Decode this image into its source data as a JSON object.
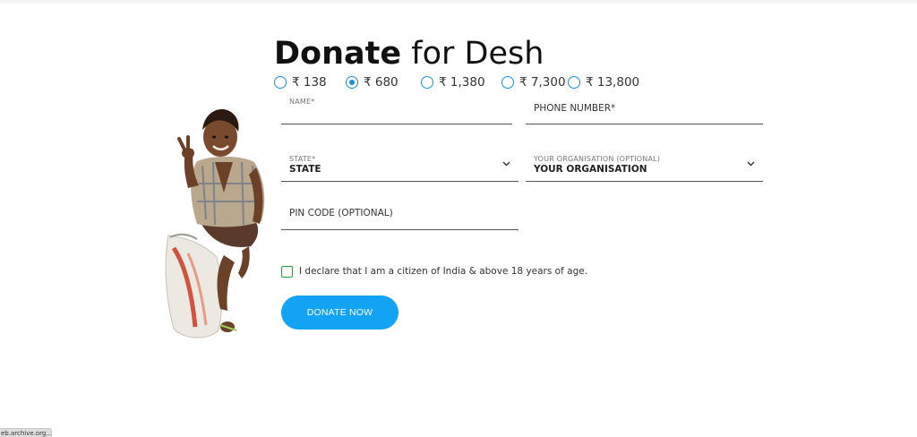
{
  "page": {
    "title_bold": "Donate",
    "title_light": "for Desh"
  },
  "amounts": [
    {
      "label": "₹ 138",
      "selected": false
    },
    {
      "label": "₹ 680",
      "selected": true
    },
    {
      "label": "₹ 1,380",
      "selected": false
    },
    {
      "label": "₹ 7,300",
      "selected": false
    },
    {
      "label": "₹ 13,800",
      "selected": false
    }
  ],
  "form": {
    "name_label": "NAME*",
    "phone_placeholder": "PHONE NUMBER*",
    "state_label": "STATE*",
    "state_value": "STATE",
    "org_label": "YOUR ORGANISATION (OPTIONAL)",
    "org_value": "YOUR ORGANISATION",
    "pin_placeholder": "PIN CODE (OPTIONAL)",
    "declaration": "I declare that I am a citizen of India & above 18 years of age.",
    "declaration_checked": false,
    "submit_label": "DONATE NOW"
  },
  "status_bar": {
    "url": "eb.archive.org..."
  },
  "colors": {
    "accent": "#12a3f5",
    "radio": "#1a8fe0",
    "checkbox": "#22a03a"
  },
  "icons": {
    "dropdown": "chevron-down-icon"
  }
}
